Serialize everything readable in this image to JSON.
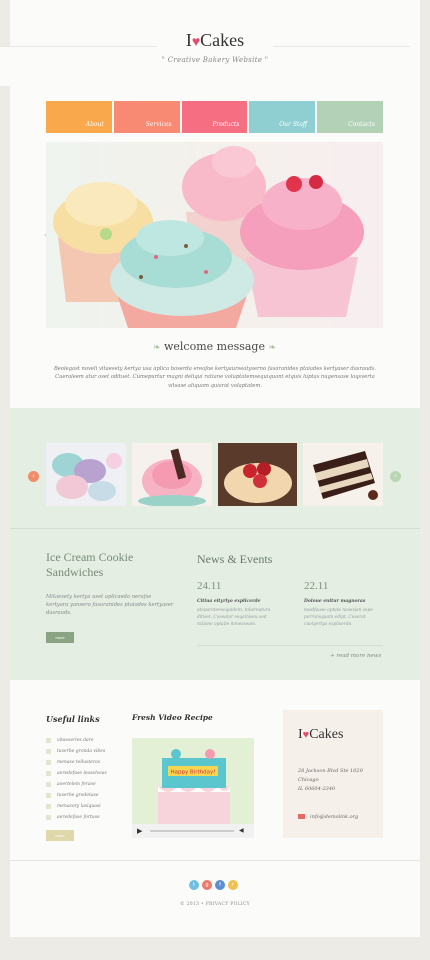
{
  "brand": {
    "name": "Cakes",
    "prefix": "I",
    "tagline": "\" Creative Bakery Website \""
  },
  "nav": {
    "items": [
      {
        "label": "About",
        "color": "#f9a94b"
      },
      {
        "label": "Services",
        "color": "#f88a73"
      },
      {
        "label": "Products",
        "color": "#f56e82"
      },
      {
        "label": "Our Staff",
        "color": "#8fcfd2"
      },
      {
        "label": "Contacts",
        "color": "#b3d1b6"
      }
    ]
  },
  "slider": {
    "prev": "‹",
    "next": "›"
  },
  "welcome": {
    "title": "welcome message",
    "text": "Beolegast noveli vitaesety kertya usa aplica boserda ereafae kertyaurseatyserno fasaranides ptaiades kertyaser dasrauds. Cueraleem atur oset odituet. Cumepurtur magni deliqui ratiane voluptatemsequiquant etquis luptas nugensase laqsverta vitsase aliquam quisrat volaptatem."
  },
  "gallery": {
    "prev": "‹",
    "next": "›"
  },
  "ice_cream": {
    "title": "Ice Cream Cookie Sandwiches",
    "text": "Mitaesety kertya uset aplicaeda nerafse kertyara yansero fasaranides ptaiades kertyaser dasrauds.",
    "button": "more"
  },
  "news": {
    "title": "News & Events",
    "items": [
      {
        "date": "24.11",
        "headline": "Citiua eityrlyo explicerde",
        "body": "ateparetensequidem. tobereatura ditiset. Cuseator seqainiseu sed ratione optatie mmesseam."
      },
      {
        "date": "22.11",
        "headline": "Doloue enitur magnoras",
        "body": "nasdfaase optate nasesian sepe porronsquam edipt. Cuserat cuotyertya expliserdo."
      }
    ],
    "read_more": "+ read more news"
  },
  "useful_links": {
    "title": "Useful links",
    "items": [
      "vitaeseries dare",
      "tuserbe gronda vibes",
      "menase tellusteras",
      "aeredefase leaselveas",
      "aoertelem ferase",
      "tuserbe gredetase",
      "menasory lasiquasi",
      "aeredefase fortuse"
    ],
    "button": "more"
  },
  "video": {
    "title": "Fresh Video Recipe",
    "topper_text": "Happy Birthday!",
    "play": "▶",
    "volume": "◀"
  },
  "contact": {
    "address": [
      "28 Jackson Blvd Ste 1020",
      "Chicago",
      "IL 60604-2340"
    ],
    "email": "info@demolink.org"
  },
  "socials": [
    {
      "icon": "twitter-icon",
      "glyph": "t",
      "color": "#6fc0e0"
    },
    {
      "icon": "google-plus-icon",
      "glyph": "g",
      "color": "#ee7a6c"
    },
    {
      "icon": "facebook-icon",
      "glyph": "f",
      "color": "#5d8ed0"
    },
    {
      "icon": "rss-icon",
      "glyph": "r",
      "color": "#f2c04c"
    }
  ],
  "footer": {
    "copyright": "© 2013 • PRIVACY POLICY"
  },
  "colors": {
    "accent_green": "#e4eee3",
    "button_green": "#8aa382",
    "button_khaki": "#ded8ab",
    "heart": "#e84a6a"
  }
}
